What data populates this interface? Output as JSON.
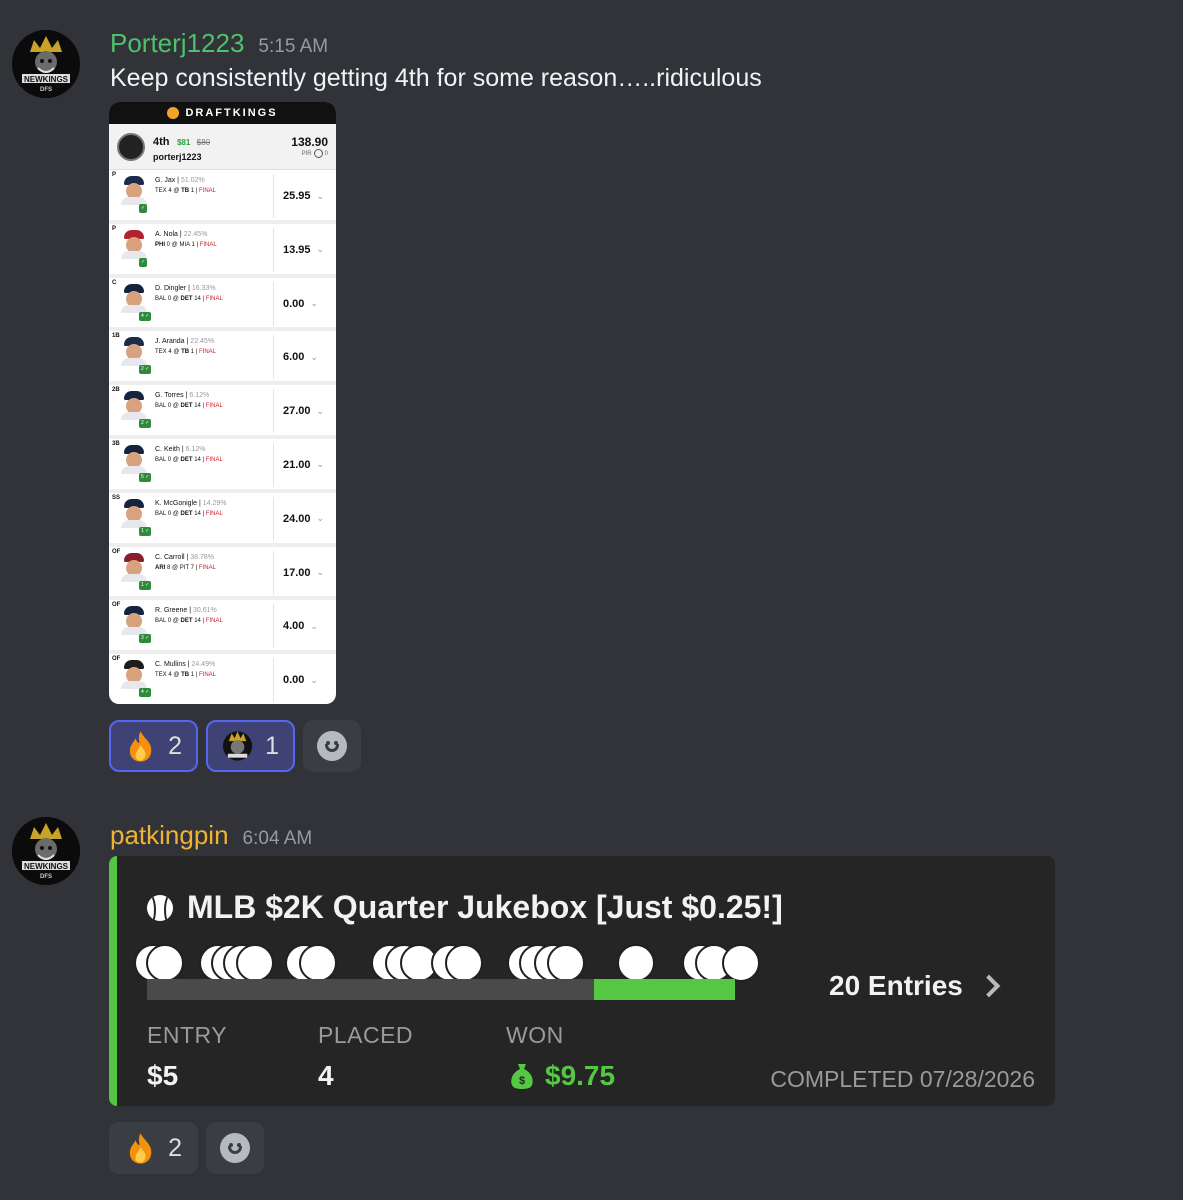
{
  "messages": [
    {
      "username": "Porterj1223",
      "time": "5:15 AM",
      "text": "Keep consistently getting 4th for some reason…..ridiculous",
      "avatar_icon": "newkings-dfs-logo",
      "attachment": {
        "brand": "DRAFTKINGS",
        "rank": "4th",
        "prize": "$81",
        "prize_old": "$80",
        "user": "porterj1223",
        "total": "138.90",
        "pir_label": "PIR",
        "pir_value": "0",
        "players": [
          {
            "pos": "P",
            "name": "G. Jax",
            "pct": "51.02%",
            "game_pre": "TEX 4 @ ",
            "game_bold": "TB",
            "game_post": " 1 | ",
            "status": "FINAL",
            "badge": "✓",
            "points": "25.95",
            "cap": "#1c2b4a"
          },
          {
            "pos": "P",
            "name": "A. Nola",
            "pct": "22.45%",
            "game_pre": "",
            "game_bold": "PHI",
            "game_post": " 0 @ MIA 1 | ",
            "status": "FINAL",
            "badge": "✓",
            "points": "13.95",
            "cap": "#b0242e"
          },
          {
            "pos": "C",
            "name": "D. Dingler",
            "pct": "16.33%",
            "game_pre": "BAL 0 @ ",
            "game_bold": "DET",
            "game_post": " 14 | ",
            "status": "FINAL",
            "badge": "4 ✓",
            "points": "0.00",
            "cap": "#14233e"
          },
          {
            "pos": "1B",
            "name": "J. Aranda",
            "pct": "22.45%",
            "game_pre": "TEX 4 @ ",
            "game_bold": "TB",
            "game_post": " 1 | ",
            "status": "FINAL",
            "badge": "2 ✓",
            "points": "6.00",
            "cap": "#1c2b4a"
          },
          {
            "pos": "2B",
            "name": "G. Torres",
            "pct": "6.12%",
            "game_pre": "BAL 0 @ ",
            "game_bold": "DET",
            "game_post": " 14 | ",
            "status": "FINAL",
            "badge": "2 ✓",
            "points": "27.00",
            "cap": "#14233e"
          },
          {
            "pos": "3B",
            "name": "C. Keith",
            "pct": "6.12%",
            "game_pre": "BAL 0 @ ",
            "game_bold": "DET",
            "game_post": " 14 | ",
            "status": "FINAL",
            "badge": "5 ✓",
            "points": "21.00",
            "cap": "#14233e"
          },
          {
            "pos": "SS",
            "name": "K. McGonigle",
            "pct": "14.29%",
            "game_pre": "BAL 0 @ ",
            "game_bold": "DET",
            "game_post": " 14 | ",
            "status": "FINAL",
            "badge": "1 ✓",
            "points": "24.00",
            "cap": "#14233e"
          },
          {
            "pos": "OF",
            "name": "C. Carroll",
            "pct": "38.78%",
            "game_pre": "",
            "game_bold": "ARI",
            "game_post": " 8 @ PIT 7 | ",
            "status": "FINAL",
            "badge": "1 ✓",
            "points": "17.00",
            "cap": "#8a1d2c"
          },
          {
            "pos": "OF",
            "name": "R. Greene",
            "pct": "30.61%",
            "game_pre": "BAL 0 @ ",
            "game_bold": "DET",
            "game_post": " 14 | ",
            "status": "FINAL",
            "badge": "3 ✓",
            "points": "4.00",
            "cap": "#14233e"
          },
          {
            "pos": "OF",
            "name": "C. Mullins",
            "pct": "24.49%",
            "game_pre": "TEX 4 @ ",
            "game_bold": "TB",
            "game_post": " 1 | ",
            "status": "FINAL",
            "badge": "4 ✓",
            "points": "0.00",
            "cap": "#1c1c1c"
          }
        ]
      },
      "reactions": [
        {
          "emoji": "fire",
          "count": "2",
          "active": true
        },
        {
          "emoji": "newkings-dfs-logo",
          "count": "1",
          "active": true
        },
        {
          "emoji": "add-reaction",
          "count": "",
          "active": false
        }
      ]
    },
    {
      "username": "patkingpin",
      "time": "6:04 AM",
      "avatar_icon": "newkings-dfs-logo",
      "embed": {
        "accent": "#53c443",
        "icon": "baseball-icon",
        "title": "MLB $2K Quarter Jukebox [Just $0.25!]",
        "entries": "20 Entries",
        "progress_fill_from": 0.76,
        "progress_fill_to": 1.0,
        "stats": [
          {
            "label": "ENTRY",
            "value": "$5"
          },
          {
            "label": "PLACED",
            "value": "4"
          },
          {
            "label": "WON",
            "value": "$9.75"
          }
        ],
        "completed": "COMPLETED 07/28/2026"
      },
      "reactions": [
        {
          "emoji": "fire",
          "count": "2",
          "active": false
        },
        {
          "emoji": "add-reaction",
          "count": "",
          "active": false
        }
      ]
    }
  ]
}
